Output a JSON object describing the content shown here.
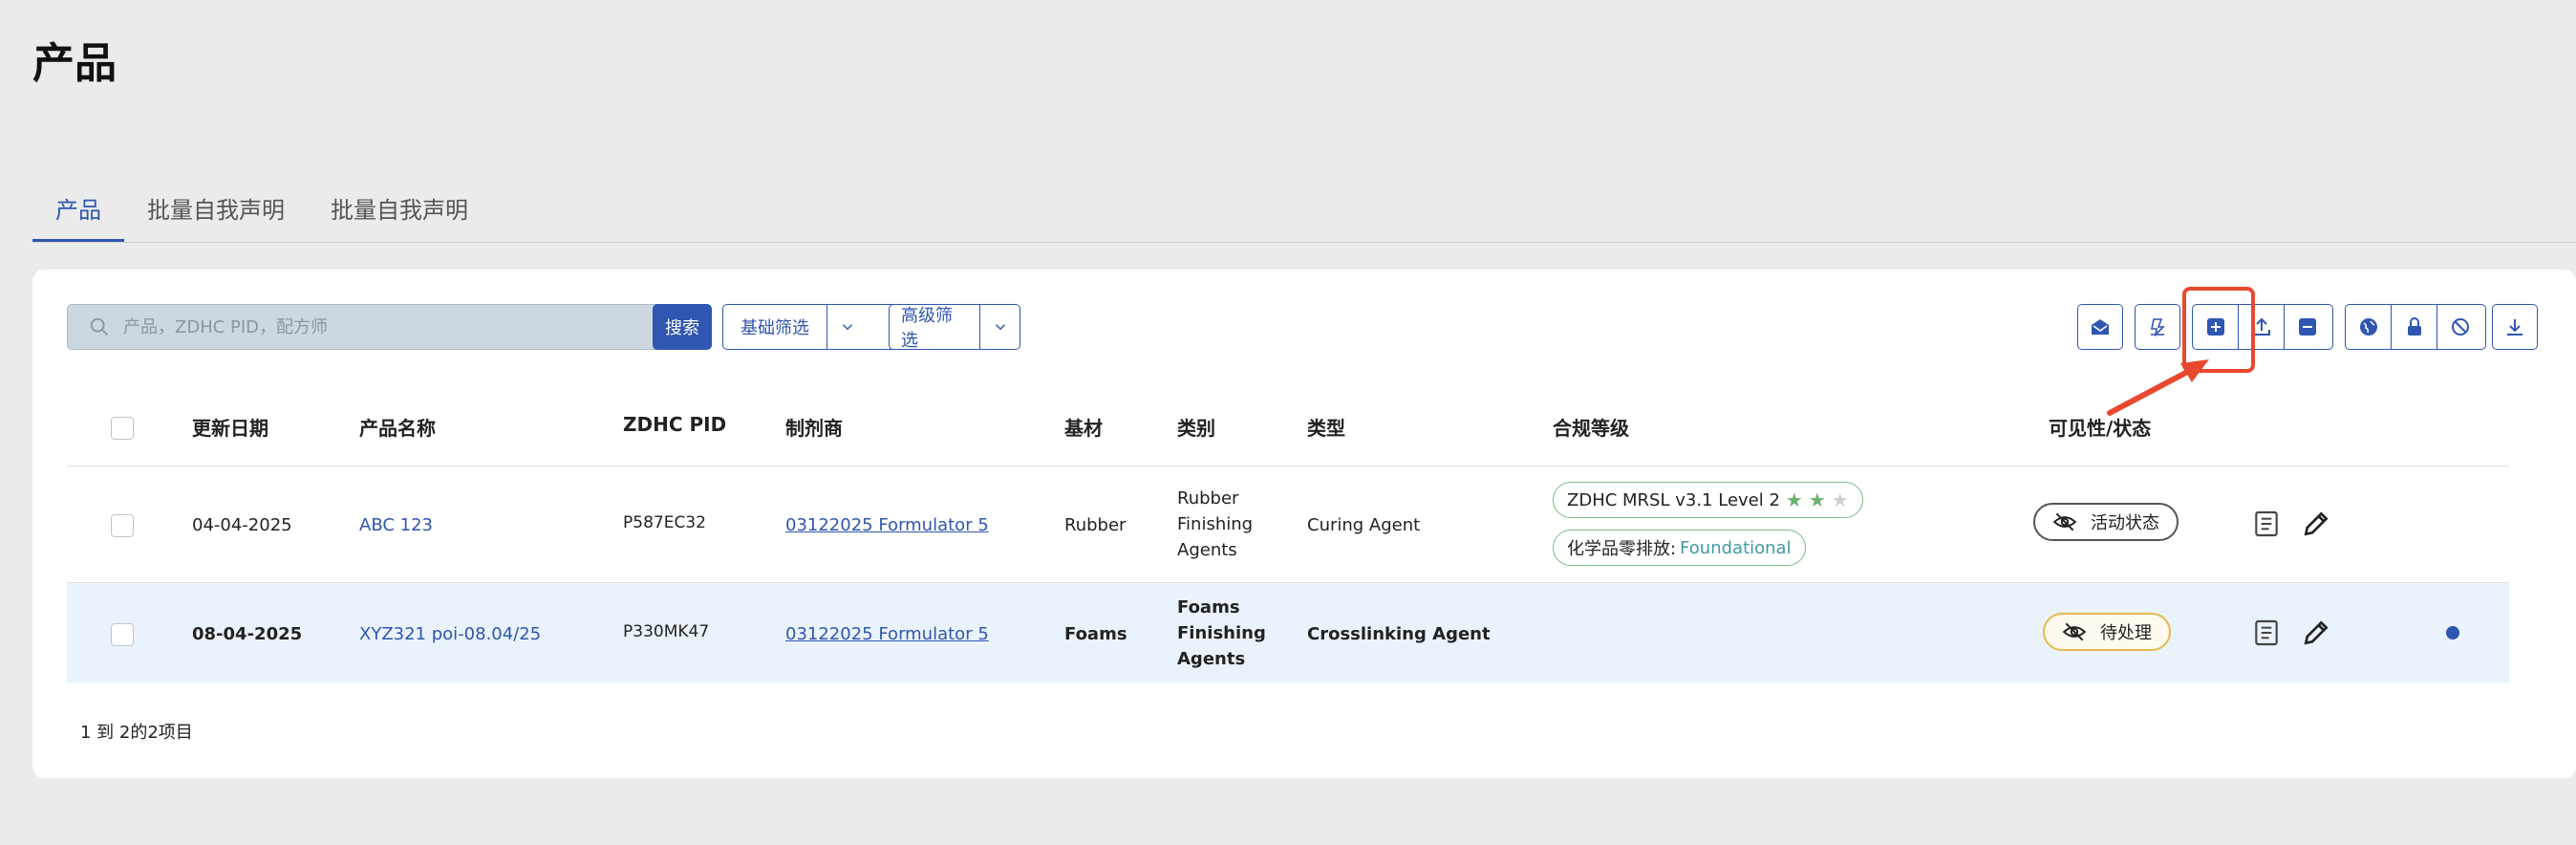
{
  "page": {
    "title": "产品"
  },
  "tabs": [
    {
      "label": "产品",
      "active": true
    },
    {
      "label": "批量自我声明",
      "active": false
    },
    {
      "label": "批量自我声明",
      "active": false
    }
  ],
  "toolbar": {
    "search_placeholder": "产品，ZDHC PID，配方师",
    "search_button": "搜索",
    "basic_filter": "基础筛选",
    "advanced_filter": "高级筛选",
    "icons": [
      "mail-open-icon",
      "certificate-icon",
      "add-icon",
      "upload-icon",
      "remove-icon",
      "globe-icon",
      "lock-icon",
      "block-icon",
      "download-icon"
    ],
    "accent_color": "#2f56b0",
    "highlight_color": "#e8492e"
  },
  "table": {
    "headers": [
      "更新日期",
      "产品名称",
      "ZDHC PID",
      "制剂商",
      "基材",
      "类别",
      "类型",
      "合规等级",
      "可见性/状态"
    ],
    "rows": [
      {
        "date": "04-04-2025",
        "name": "ABC 123",
        "pid": "P587EC32",
        "formulator": "03122025 Formulator 5",
        "substrate": "Rubber",
        "category": [
          "Rubber",
          "Finishing",
          "Agents"
        ],
        "type": "Curing Agent",
        "compliance": {
          "mrsl": "ZDHC MRSL v3.1 Level 2",
          "stars": 2,
          "zero_label": "化学品零排放:",
          "zero_value": "Foundational"
        },
        "status": "活动状态"
      },
      {
        "date": "08-04-2025",
        "name": "XYZ321 poi-08.04/25",
        "pid": "P330MK47",
        "formulator": "03122025 Formulator 5",
        "substrate": "Foams",
        "category": [
          "Foams",
          "Finishing",
          "Agents"
        ],
        "type": "Crosslinking Agent",
        "status": "待处理"
      }
    ]
  },
  "footer": {
    "text": "1 到 2的2项目"
  }
}
